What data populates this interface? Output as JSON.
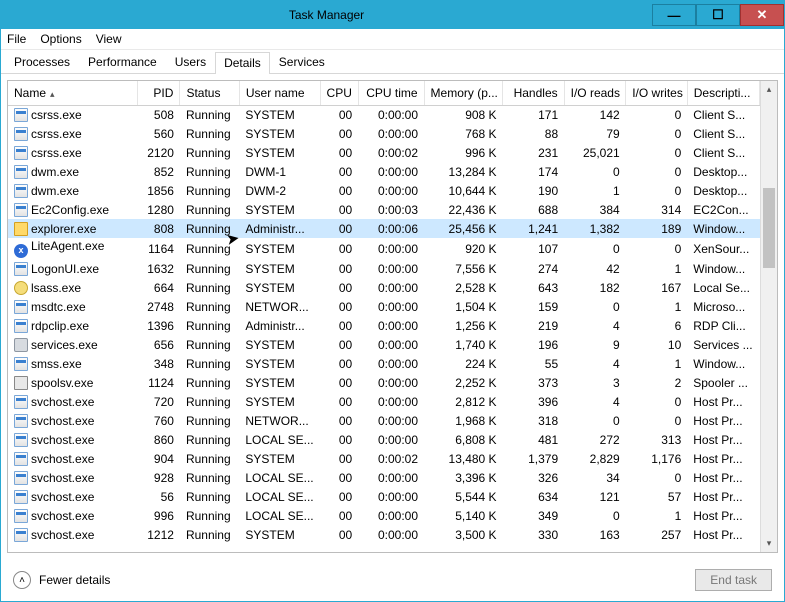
{
  "window": {
    "title": "Task Manager"
  },
  "menu": {
    "file": "File",
    "options": "Options",
    "view": "View"
  },
  "tabs": {
    "items": [
      "Processes",
      "Performance",
      "Users",
      "Details",
      "Services"
    ],
    "activeIndex": 3
  },
  "columns": [
    {
      "key": "name",
      "label": "Name",
      "w": 122,
      "align": "left",
      "sorted": true
    },
    {
      "key": "pid",
      "label": "PID",
      "w": 40,
      "align": "right"
    },
    {
      "key": "status",
      "label": "Status",
      "w": 56,
      "align": "left"
    },
    {
      "key": "user",
      "label": "User name",
      "w": 76,
      "align": "left"
    },
    {
      "key": "cpu",
      "label": "CPU",
      "w": 36,
      "align": "right"
    },
    {
      "key": "cputime",
      "label": "CPU time",
      "w": 62,
      "align": "right"
    },
    {
      "key": "mem",
      "label": "Memory (p...",
      "w": 74,
      "align": "right"
    },
    {
      "key": "handles",
      "label": "Handles",
      "w": 58,
      "align": "right"
    },
    {
      "key": "ioreads",
      "label": "I/O reads",
      "w": 58,
      "align": "right"
    },
    {
      "key": "iowrites",
      "label": "I/O writes",
      "w": 58,
      "align": "right"
    },
    {
      "key": "desc",
      "label": "Descripti...",
      "w": 68,
      "align": "left"
    }
  ],
  "rows": [
    {
      "icon": "app",
      "name": "csrss.exe",
      "pid": "508",
      "status": "Running",
      "user": "SYSTEM",
      "cpu": "00",
      "cputime": "0:00:00",
      "mem": "908 K",
      "handles": "171",
      "ioreads": "142",
      "iowrites": "0",
      "desc": "Client S..."
    },
    {
      "icon": "app",
      "name": "csrss.exe",
      "pid": "560",
      "status": "Running",
      "user": "SYSTEM",
      "cpu": "00",
      "cputime": "0:00:00",
      "mem": "768 K",
      "handles": "88",
      "ioreads": "79",
      "iowrites": "0",
      "desc": "Client S..."
    },
    {
      "icon": "app",
      "name": "csrss.exe",
      "pid": "2120",
      "status": "Running",
      "user": "SYSTEM",
      "cpu": "00",
      "cputime": "0:00:02",
      "mem": "996 K",
      "handles": "231",
      "ioreads": "25,021",
      "iowrites": "0",
      "desc": "Client S..."
    },
    {
      "icon": "app",
      "name": "dwm.exe",
      "pid": "852",
      "status": "Running",
      "user": "DWM-1",
      "cpu": "00",
      "cputime": "0:00:00",
      "mem": "13,284 K",
      "handles": "174",
      "ioreads": "0",
      "iowrites": "0",
      "desc": "Desktop..."
    },
    {
      "icon": "app",
      "name": "dwm.exe",
      "pid": "1856",
      "status": "Running",
      "user": "DWM-2",
      "cpu": "00",
      "cputime": "0:00:00",
      "mem": "10,644 K",
      "handles": "190",
      "ioreads": "1",
      "iowrites": "0",
      "desc": "Desktop..."
    },
    {
      "icon": "app",
      "name": "Ec2Config.exe",
      "pid": "1280",
      "status": "Running",
      "user": "SYSTEM",
      "cpu": "00",
      "cputime": "0:00:03",
      "mem": "22,436 K",
      "handles": "688",
      "ioreads": "384",
      "iowrites": "314",
      "desc": "EC2Con..."
    },
    {
      "icon": "folder",
      "name": "explorer.exe",
      "pid": "808",
      "status": "Running",
      "user": "Administr...",
      "cpu": "00",
      "cputime": "0:00:06",
      "mem": "25,456 K",
      "handles": "1,241",
      "ioreads": "1,382",
      "iowrites": "189",
      "desc": "Window...",
      "selected": true
    },
    {
      "icon": "blue",
      "name": "LiteAgent.exe",
      "pid": "1164",
      "status": "Running",
      "user": "SYSTEM",
      "cpu": "00",
      "cputime": "0:00:00",
      "mem": "920 K",
      "handles": "107",
      "ioreads": "0",
      "iowrites": "0",
      "desc": "XenSour..."
    },
    {
      "icon": "app",
      "name": "LogonUI.exe",
      "pid": "1632",
      "status": "Running",
      "user": "SYSTEM",
      "cpu": "00",
      "cputime": "0:00:00",
      "mem": "7,556 K",
      "handles": "274",
      "ioreads": "42",
      "iowrites": "1",
      "desc": "Window..."
    },
    {
      "icon": "key",
      "name": "lsass.exe",
      "pid": "664",
      "status": "Running",
      "user": "SYSTEM",
      "cpu": "00",
      "cputime": "0:00:00",
      "mem": "2,528 K",
      "handles": "643",
      "ioreads": "182",
      "iowrites": "167",
      "desc": "Local Se..."
    },
    {
      "icon": "app",
      "name": "msdtc.exe",
      "pid": "2748",
      "status": "Running",
      "user": "NETWOR...",
      "cpu": "00",
      "cputime": "0:00:00",
      "mem": "1,504 K",
      "handles": "159",
      "ioreads": "0",
      "iowrites": "1",
      "desc": "Microso..."
    },
    {
      "icon": "app",
      "name": "rdpclip.exe",
      "pid": "1396",
      "status": "Running",
      "user": "Administr...",
      "cpu": "00",
      "cputime": "0:00:00",
      "mem": "1,256 K",
      "handles": "219",
      "ioreads": "4",
      "iowrites": "6",
      "desc": "RDP Cli..."
    },
    {
      "icon": "gear",
      "name": "services.exe",
      "pid": "656",
      "status": "Running",
      "user": "SYSTEM",
      "cpu": "00",
      "cputime": "0:00:00",
      "mem": "1,740 K",
      "handles": "196",
      "ioreads": "9",
      "iowrites": "10",
      "desc": "Services ..."
    },
    {
      "icon": "app",
      "name": "smss.exe",
      "pid": "348",
      "status": "Running",
      "user": "SYSTEM",
      "cpu": "00",
      "cputime": "0:00:00",
      "mem": "224 K",
      "handles": "55",
      "ioreads": "4",
      "iowrites": "1",
      "desc": "Window..."
    },
    {
      "icon": "print",
      "name": "spoolsv.exe",
      "pid": "1124",
      "status": "Running",
      "user": "SYSTEM",
      "cpu": "00",
      "cputime": "0:00:00",
      "mem": "2,252 K",
      "handles": "373",
      "ioreads": "3",
      "iowrites": "2",
      "desc": "Spooler ..."
    },
    {
      "icon": "app",
      "name": "svchost.exe",
      "pid": "720",
      "status": "Running",
      "user": "SYSTEM",
      "cpu": "00",
      "cputime": "0:00:00",
      "mem": "2,812 K",
      "handles": "396",
      "ioreads": "4",
      "iowrites": "0",
      "desc": "Host Pr..."
    },
    {
      "icon": "app",
      "name": "svchost.exe",
      "pid": "760",
      "status": "Running",
      "user": "NETWOR...",
      "cpu": "00",
      "cputime": "0:00:00",
      "mem": "1,968 K",
      "handles": "318",
      "ioreads": "0",
      "iowrites": "0",
      "desc": "Host Pr..."
    },
    {
      "icon": "app",
      "name": "svchost.exe",
      "pid": "860",
      "status": "Running",
      "user": "LOCAL SE...",
      "cpu": "00",
      "cputime": "0:00:00",
      "mem": "6,808 K",
      "handles": "481",
      "ioreads": "272",
      "iowrites": "313",
      "desc": "Host Pr..."
    },
    {
      "icon": "app",
      "name": "svchost.exe",
      "pid": "904",
      "status": "Running",
      "user": "SYSTEM",
      "cpu": "00",
      "cputime": "0:00:02",
      "mem": "13,480 K",
      "handles": "1,379",
      "ioreads": "2,829",
      "iowrites": "1,176",
      "desc": "Host Pr..."
    },
    {
      "icon": "app",
      "name": "svchost.exe",
      "pid": "928",
      "status": "Running",
      "user": "LOCAL SE...",
      "cpu": "00",
      "cputime": "0:00:00",
      "mem": "3,396 K",
      "handles": "326",
      "ioreads": "34",
      "iowrites": "0",
      "desc": "Host Pr..."
    },
    {
      "icon": "app",
      "name": "svchost.exe",
      "pid": "56",
      "status": "Running",
      "user": "LOCAL SE...",
      "cpu": "00",
      "cputime": "0:00:00",
      "mem": "5,544 K",
      "handles": "634",
      "ioreads": "121",
      "iowrites": "57",
      "desc": "Host Pr..."
    },
    {
      "icon": "app",
      "name": "svchost.exe",
      "pid": "996",
      "status": "Running",
      "user": "LOCAL SE...",
      "cpu": "00",
      "cputime": "0:00:00",
      "mem": "5,140 K",
      "handles": "349",
      "ioreads": "0",
      "iowrites": "1",
      "desc": "Host Pr..."
    },
    {
      "icon": "app",
      "name": "svchost.exe",
      "pid": "1212",
      "status": "Running",
      "user": "SYSTEM",
      "cpu": "00",
      "cputime": "0:00:00",
      "mem": "3,500 K",
      "handles": "330",
      "ioreads": "163",
      "iowrites": "257",
      "desc": "Host Pr..."
    }
  ],
  "footer": {
    "fewer": "Fewer details",
    "endtask": "End task"
  }
}
